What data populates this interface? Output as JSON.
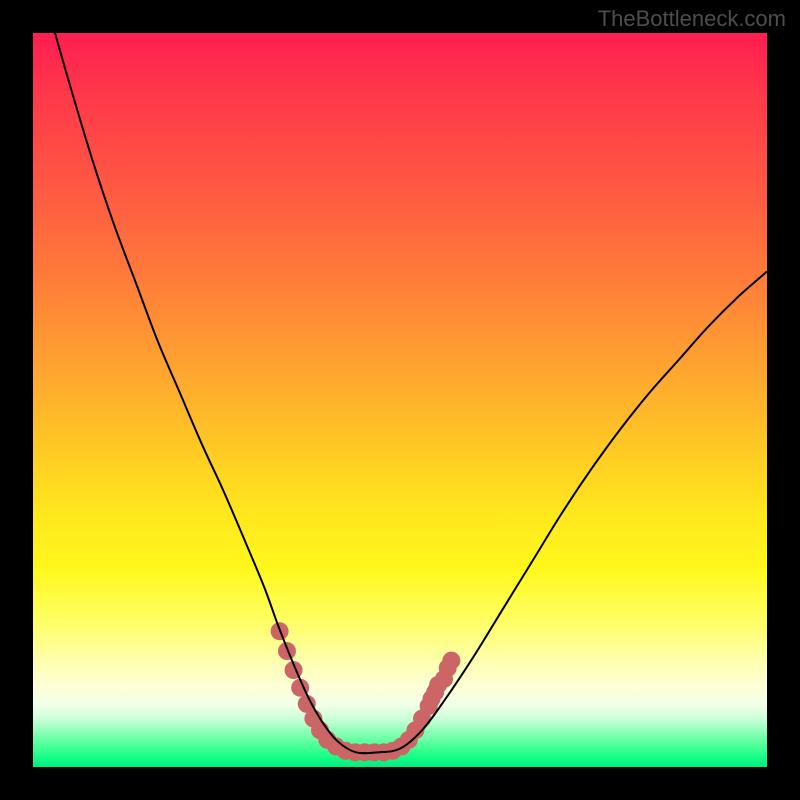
{
  "watermark": "TheBottleneck.com",
  "chart_data": {
    "type": "line",
    "title": "",
    "xlabel": "",
    "ylabel": "",
    "xlim": [
      0,
      100
    ],
    "ylim": [
      0,
      100
    ],
    "grid": false,
    "series": [
      {
        "name": "bottleneck-curve",
        "color": "#000000",
        "stroke_width": 2,
        "x": [
          3,
          5,
          8,
          11,
          14,
          17,
          20,
          23,
          26,
          29,
          31.5,
          33.5,
          35.5,
          37.5,
          39.5,
          41.5,
          44,
          47,
          50,
          53,
          56,
          60,
          64,
          68,
          72,
          76,
          80,
          84,
          88,
          92,
          96,
          100
        ],
        "y": [
          100,
          93,
          83,
          74,
          66,
          58,
          51,
          44,
          37.5,
          30.5,
          24.5,
          19,
          14,
          9.5,
          6,
          3.5,
          2,
          2,
          2.5,
          5,
          9,
          15,
          21.5,
          28,
          34.5,
          40.5,
          46,
          51,
          55.5,
          60,
          64,
          67.5
        ]
      }
    ],
    "markers": [
      {
        "name": "highlight-cluster",
        "color": "#cc6666",
        "radius_px": 9,
        "points": [
          {
            "x": 33.6,
            "y": 18.5
          },
          {
            "x": 34.6,
            "y": 15.8
          },
          {
            "x": 35.5,
            "y": 13.2
          },
          {
            "x": 36.4,
            "y": 10.8
          },
          {
            "x": 37.3,
            "y": 8.6
          },
          {
            "x": 38.2,
            "y": 6.6
          },
          {
            "x": 39.1,
            "y": 5.0
          },
          {
            "x": 40.1,
            "y": 3.7
          },
          {
            "x": 41.3,
            "y": 2.8
          },
          {
            "x": 42.6,
            "y": 2.2
          },
          {
            "x": 43.9,
            "y": 2.0
          },
          {
            "x": 45.2,
            "y": 2.0
          },
          {
            "x": 46.5,
            "y": 2.0
          },
          {
            "x": 47.8,
            "y": 2.0
          },
          {
            "x": 49.0,
            "y": 2.2
          },
          {
            "x": 50.2,
            "y": 2.8
          },
          {
            "x": 51.2,
            "y": 3.7
          },
          {
            "x": 52.1,
            "y": 5.0
          },
          {
            "x": 53.0,
            "y": 6.6
          },
          {
            "x": 53.9,
            "y": 8.3
          },
          {
            "x": 54.3,
            "y": 9.3
          },
          {
            "x": 54.8,
            "y": 10.2
          },
          {
            "x": 55.2,
            "y": 11.2
          },
          {
            "x": 56.0,
            "y": 12.0
          },
          {
            "x": 56.5,
            "y": 13.5
          },
          {
            "x": 57.0,
            "y": 14.5
          }
        ]
      }
    ]
  },
  "colors": {
    "background": "#000000",
    "curve": "#000000",
    "marker": "#cc6666",
    "watermark": "#4d4d4d"
  }
}
